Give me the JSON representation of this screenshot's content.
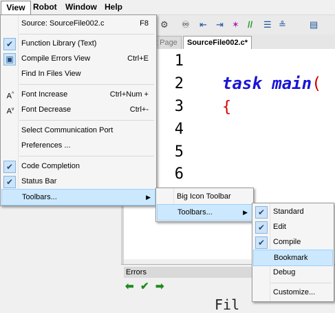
{
  "menubar": {
    "items": [
      "View",
      "Robot",
      "Window",
      "Help"
    ]
  },
  "tabs": {
    "start_page": "t Page",
    "source_file": "SourceFile002.c*"
  },
  "editor": {
    "line_numbers": [
      "1",
      "2",
      "3",
      "4",
      "5",
      "6"
    ],
    "code_keyword": "task main",
    "code_paren": "(",
    "code_brace": "{"
  },
  "errors": {
    "title": "Errors",
    "content": "Fil"
  },
  "view_menu": {
    "source_label": "Source: SourceFile002.c",
    "source_shortcut": "F8",
    "function_library": "Function Library (Text)",
    "compile_errors": "Compile Errors View",
    "compile_errors_shortcut": "Ctrl+E",
    "find_in_files": "Find In Files View",
    "font_increase": "Font Increase",
    "font_increase_shortcut": "Ctrl+Num +",
    "font_decrease": "Font Decrease",
    "font_decrease_shortcut": "Ctrl+-",
    "select_port": "Select Communication Port",
    "preferences": "Preferences ...",
    "code_completion": "Code Completion",
    "status_bar": "Status Bar",
    "toolbars": "Toolbars..."
  },
  "toolbars_menu": {
    "big_icon": "Big Icon Toolbar",
    "toolbars": "Toolbars..."
  },
  "toolbar_list_menu": {
    "standard": "Standard",
    "edit": "Edit",
    "compile": "Compile",
    "bookmark": "Bookmark",
    "debug": "Debug",
    "customize": "Customize..."
  },
  "colors": {
    "keyword": "#1a14d8",
    "paren": "#d40000",
    "highlight": "#cce8ff"
  }
}
